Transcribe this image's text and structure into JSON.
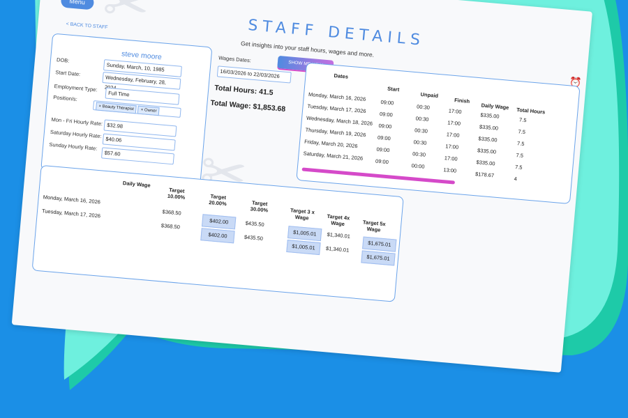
{
  "menu_label": "Menu",
  "title": "STAFF DETAILS",
  "subtitle": "Get insights into your staff hours, wages and more.",
  "show_me_label": "SHOW ME HOW",
  "back_label": "< BACK TO STAFF",
  "profile": {
    "name": "steve moore",
    "dob_label": "DOB:",
    "dob": "Sunday, March, 10, 1985",
    "start_label": "Start Date:",
    "start": "Wednesday, February, 28, 2024",
    "emp_label": "Employment Type:",
    "emp": "Full Time",
    "pos_label": "Position/s:",
    "positions": [
      "× Beauty Therapist",
      "× Owner"
    ],
    "mf_label": "Mon - Fri Hourly Rate:",
    "mf": "$32.98",
    "sat_label": "Saturday Hourly Rate:",
    "sat": "$40.06",
    "sun_label": "Sunday Hourly Rate:",
    "sun": "$57.60"
  },
  "wages": {
    "dates_label": "Wages Dates:",
    "dates": "16/03/2026 to 22/03/2026",
    "total_hours": "Total Hours: 41.5",
    "total_wage": "Total Wage: $1,853.68"
  },
  "hours_table": {
    "headers": [
      "Dates",
      "Start",
      "Unpaid",
      "Finish",
      "Daily Wage",
      "Total Hours"
    ],
    "rows": [
      [
        "Monday, March 16, 2026",
        "09:00",
        "00:30",
        "17:00",
        "$335.00",
        "7.5"
      ],
      [
        "Tuesday, March 17, 2026",
        "09:00",
        "00:30",
        "17:00",
        "$335.00",
        "7.5"
      ],
      [
        "Wednesday, March 18, 2026",
        "09:00",
        "00:30",
        "17:00",
        "$335.00",
        "7.5"
      ],
      [
        "Thursday, March 19, 2026",
        "09:00",
        "00:30",
        "17:00",
        "$335.00",
        "7.5"
      ],
      [
        "Friday, March 20, 2026",
        "09:00",
        "00:30",
        "17:00",
        "$335.00",
        "7.5"
      ],
      [
        "Saturday, March 21, 2026",
        "09:00",
        "00:00",
        "13:00",
        "$178.67",
        "4"
      ]
    ]
  },
  "target_table": {
    "headers": [
      "Daily Wage",
      "Target 10.00%",
      "Target 20.00%",
      "Target 30.00%",
      "Target 3 x Wage",
      "Target 4x Wage",
      "Target 5x Wage"
    ],
    "rows": [
      [
        "Monday, March 16, 2026",
        "",
        "$368.50",
        "$402.00",
        "$435.50",
        "$1,005.01",
        "$1,340.01",
        "$1,675.01"
      ],
      [
        "Tuesday, March 17, 2026",
        "",
        "$368.50",
        "$402.00",
        "$435.50",
        "$1,005.01",
        "$1,340.01",
        "$1,675.01"
      ]
    ]
  }
}
